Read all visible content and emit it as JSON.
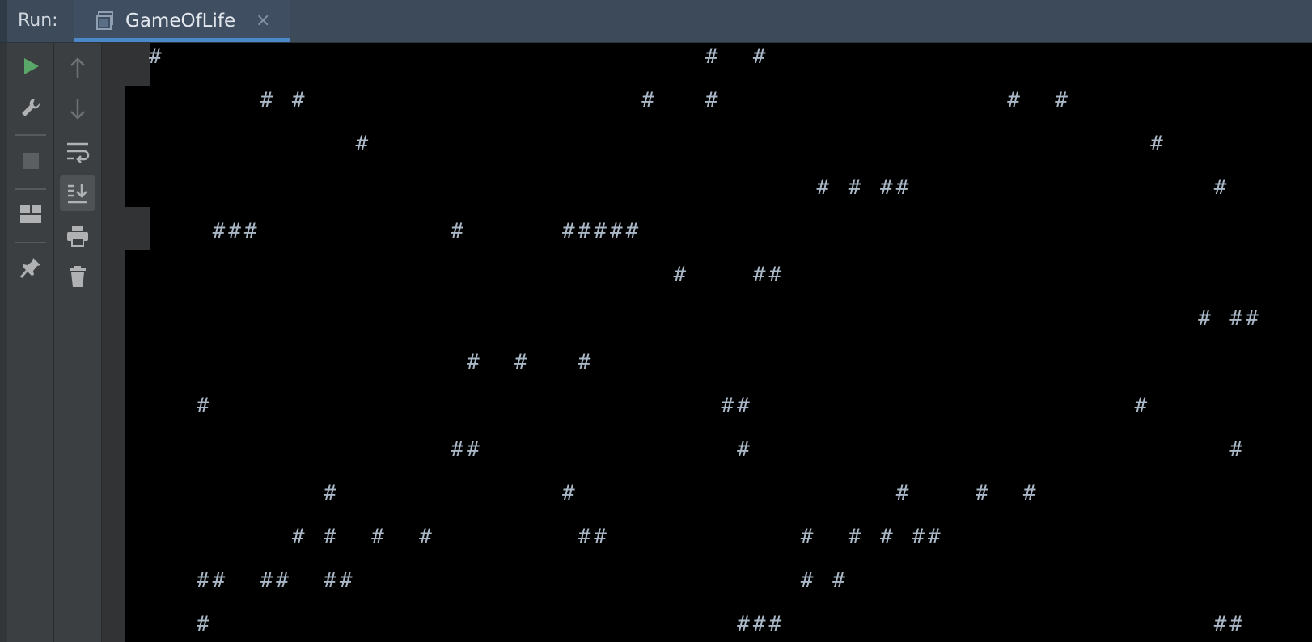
{
  "header": {
    "run_label": "Run:",
    "tab": {
      "title": "GameOfLife",
      "close": "×",
      "icon": "console-window-icon"
    }
  },
  "toolbar_left": [
    {
      "name": "rerun-icon",
      "color": "#59a869"
    },
    {
      "name": "wrench-icon"
    },
    {
      "name": "stop-icon"
    },
    {
      "name": "layout-icon"
    },
    {
      "name": "pin-icon"
    }
  ],
  "toolbar_right": [
    {
      "name": "arrow-up-icon"
    },
    {
      "name": "arrow-down-icon"
    },
    {
      "name": "soft-wrap-icon"
    },
    {
      "name": "scroll-to-end-icon",
      "active": true
    },
    {
      "name": "print-icon"
    },
    {
      "name": "trash-icon"
    }
  ],
  "console": {
    "lines": [
      "#                                  #  #",
      "       # #                     #   #                  #  #",
      "             #                                                 #",
      "                                          # # ##                   #",
      "    ###            #      #####",
      "                                 #    ##",
      "                                                                  # ##",
      "                    #  #   #",
      "   #                                ##                        #",
      "                   ##                #                              #",
      "           #              #                    #    #  #",
      "         # #  #  #         ##            #  # # ##",
      "   ##  ##  ##                            # #",
      "   #                                 ###                           ##"
    ]
  }
}
